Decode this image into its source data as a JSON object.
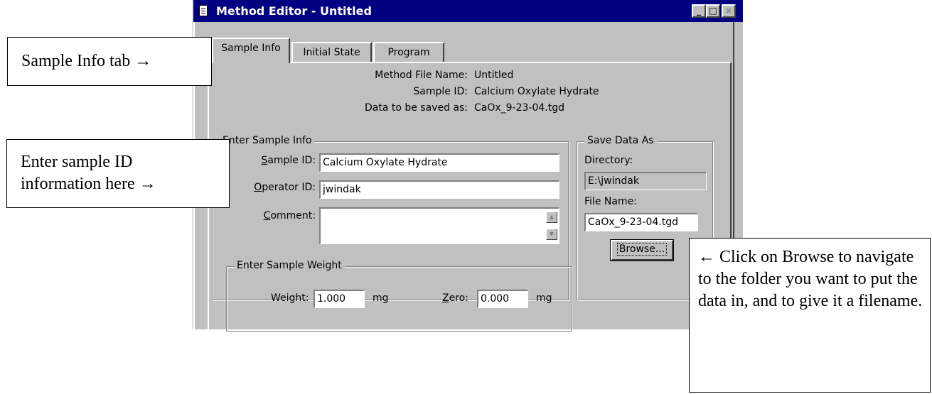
{
  "window": {
    "title": "Method Editor - Untitled",
    "minimize_glyph": "_",
    "maximize_glyph": "□",
    "close_glyph": "×"
  },
  "tabs": [
    {
      "label": "Sample Info",
      "active": true
    },
    {
      "label": "Initial State",
      "active": false
    },
    {
      "label": "Program",
      "active": false
    }
  ],
  "summary": {
    "method_file_label": "Method File Name:",
    "method_file_value": "Untitled",
    "sample_id_label": "Sample ID:",
    "sample_id_value": "Calcium Oxylate Hydrate",
    "saved_as_label": "Data to be saved as:",
    "saved_as_value": "CaOx_9-23-04.tgd"
  },
  "sample_info": {
    "group_title": "Enter Sample Info",
    "sample_id_label": "Sample ID:",
    "sample_id_value": "Calcium Oxylate Hydrate",
    "operator_id_label": "Operator ID:",
    "operator_id_value": "jwindak",
    "comment_label": "Comment:",
    "comment_value": ""
  },
  "save_data": {
    "group_title": "Save Data As",
    "directory_label": "Directory:",
    "directory_value": "E:\\jwindak",
    "file_name_label": "File Name:",
    "file_name_value": "CaOx_9-23-04.tgd",
    "browse_label": "Browse..."
  },
  "sample_weight": {
    "group_title": "Enter Sample Weight",
    "weight_label": "Weight:",
    "weight_value": "1.000",
    "weight_unit": "mg",
    "zero_label": "Zero:",
    "zero_value": "0.000",
    "zero_unit": "mg"
  },
  "callouts": {
    "tab_note": "Sample Info tab →",
    "id_note_line1": "Enter sample ID",
    "id_note_line2": "information here →",
    "browse_note": "← Click on Browse to navigate to the folder you want to put the data in, and to give it a filename."
  }
}
